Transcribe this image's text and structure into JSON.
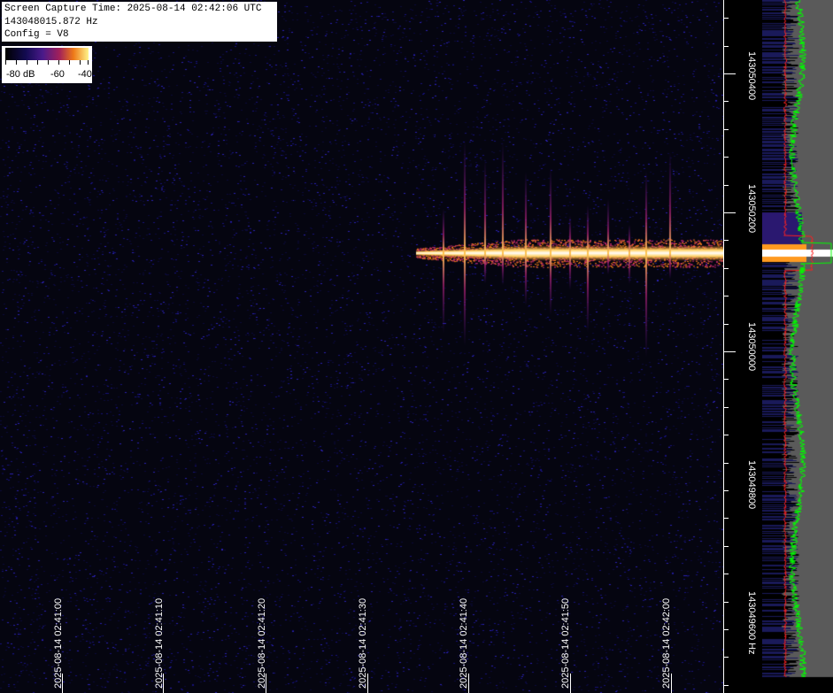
{
  "info": {
    "capture_time": "Screen Capture Time: 2025-08-14 02:42:06 UTC",
    "center_freq": "143048015.872 Hz",
    "config": "Config = V8"
  },
  "legend": {
    "labels": [
      "-80 dB",
      "-60",
      "-40"
    ],
    "db_min": -80,
    "db_max": -40
  },
  "time_axis": {
    "labels": [
      "2025-08-14 02:41:00",
      "2025-08-14 02:41:10",
      "2025-08-14 02:41:20",
      "2025-08-14 02:41:30",
      "2025-08-14 02:41:40",
      "2025-08-14 02:41:50",
      "2025-08-14 02:42:00"
    ]
  },
  "freq_axis": {
    "labels": [
      "143050400",
      "143050200",
      "143050000",
      "143049800",
      "143049600 Hz"
    ]
  },
  "colors": {
    "background": "#000000",
    "noise": "#14108a",
    "signal_core": "#ffffff",
    "spectrum_fill": "#5a5a5a",
    "spectrum_green": "#00ff00",
    "spectrum_red": "#ff2020"
  }
}
